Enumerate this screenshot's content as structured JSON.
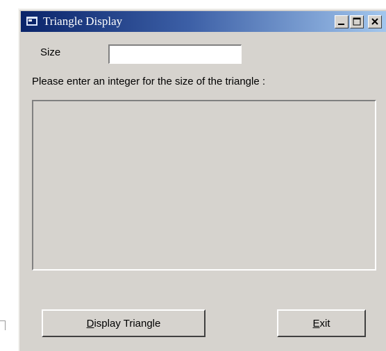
{
  "window": {
    "title": "Triangle Display",
    "minimize_label": "_",
    "maximize_label": "□",
    "close_label": "x"
  },
  "form": {
    "size_label": "Size",
    "size_value": "",
    "prompt": "Please enter an integer for the size of the triangle :",
    "output_text": ""
  },
  "buttons": {
    "display": {
      "mnemonic": "D",
      "rest": "isplay Triangle"
    },
    "exit": {
      "mnemonic": "E",
      "rest": "xit"
    }
  },
  "colors": {
    "face": "#d6d3ce",
    "title_start": "#0a246a",
    "title_end": "#a6caf0"
  },
  "icons": [
    "app-icon",
    "minimize-icon",
    "maximize-icon",
    "close-icon"
  ]
}
